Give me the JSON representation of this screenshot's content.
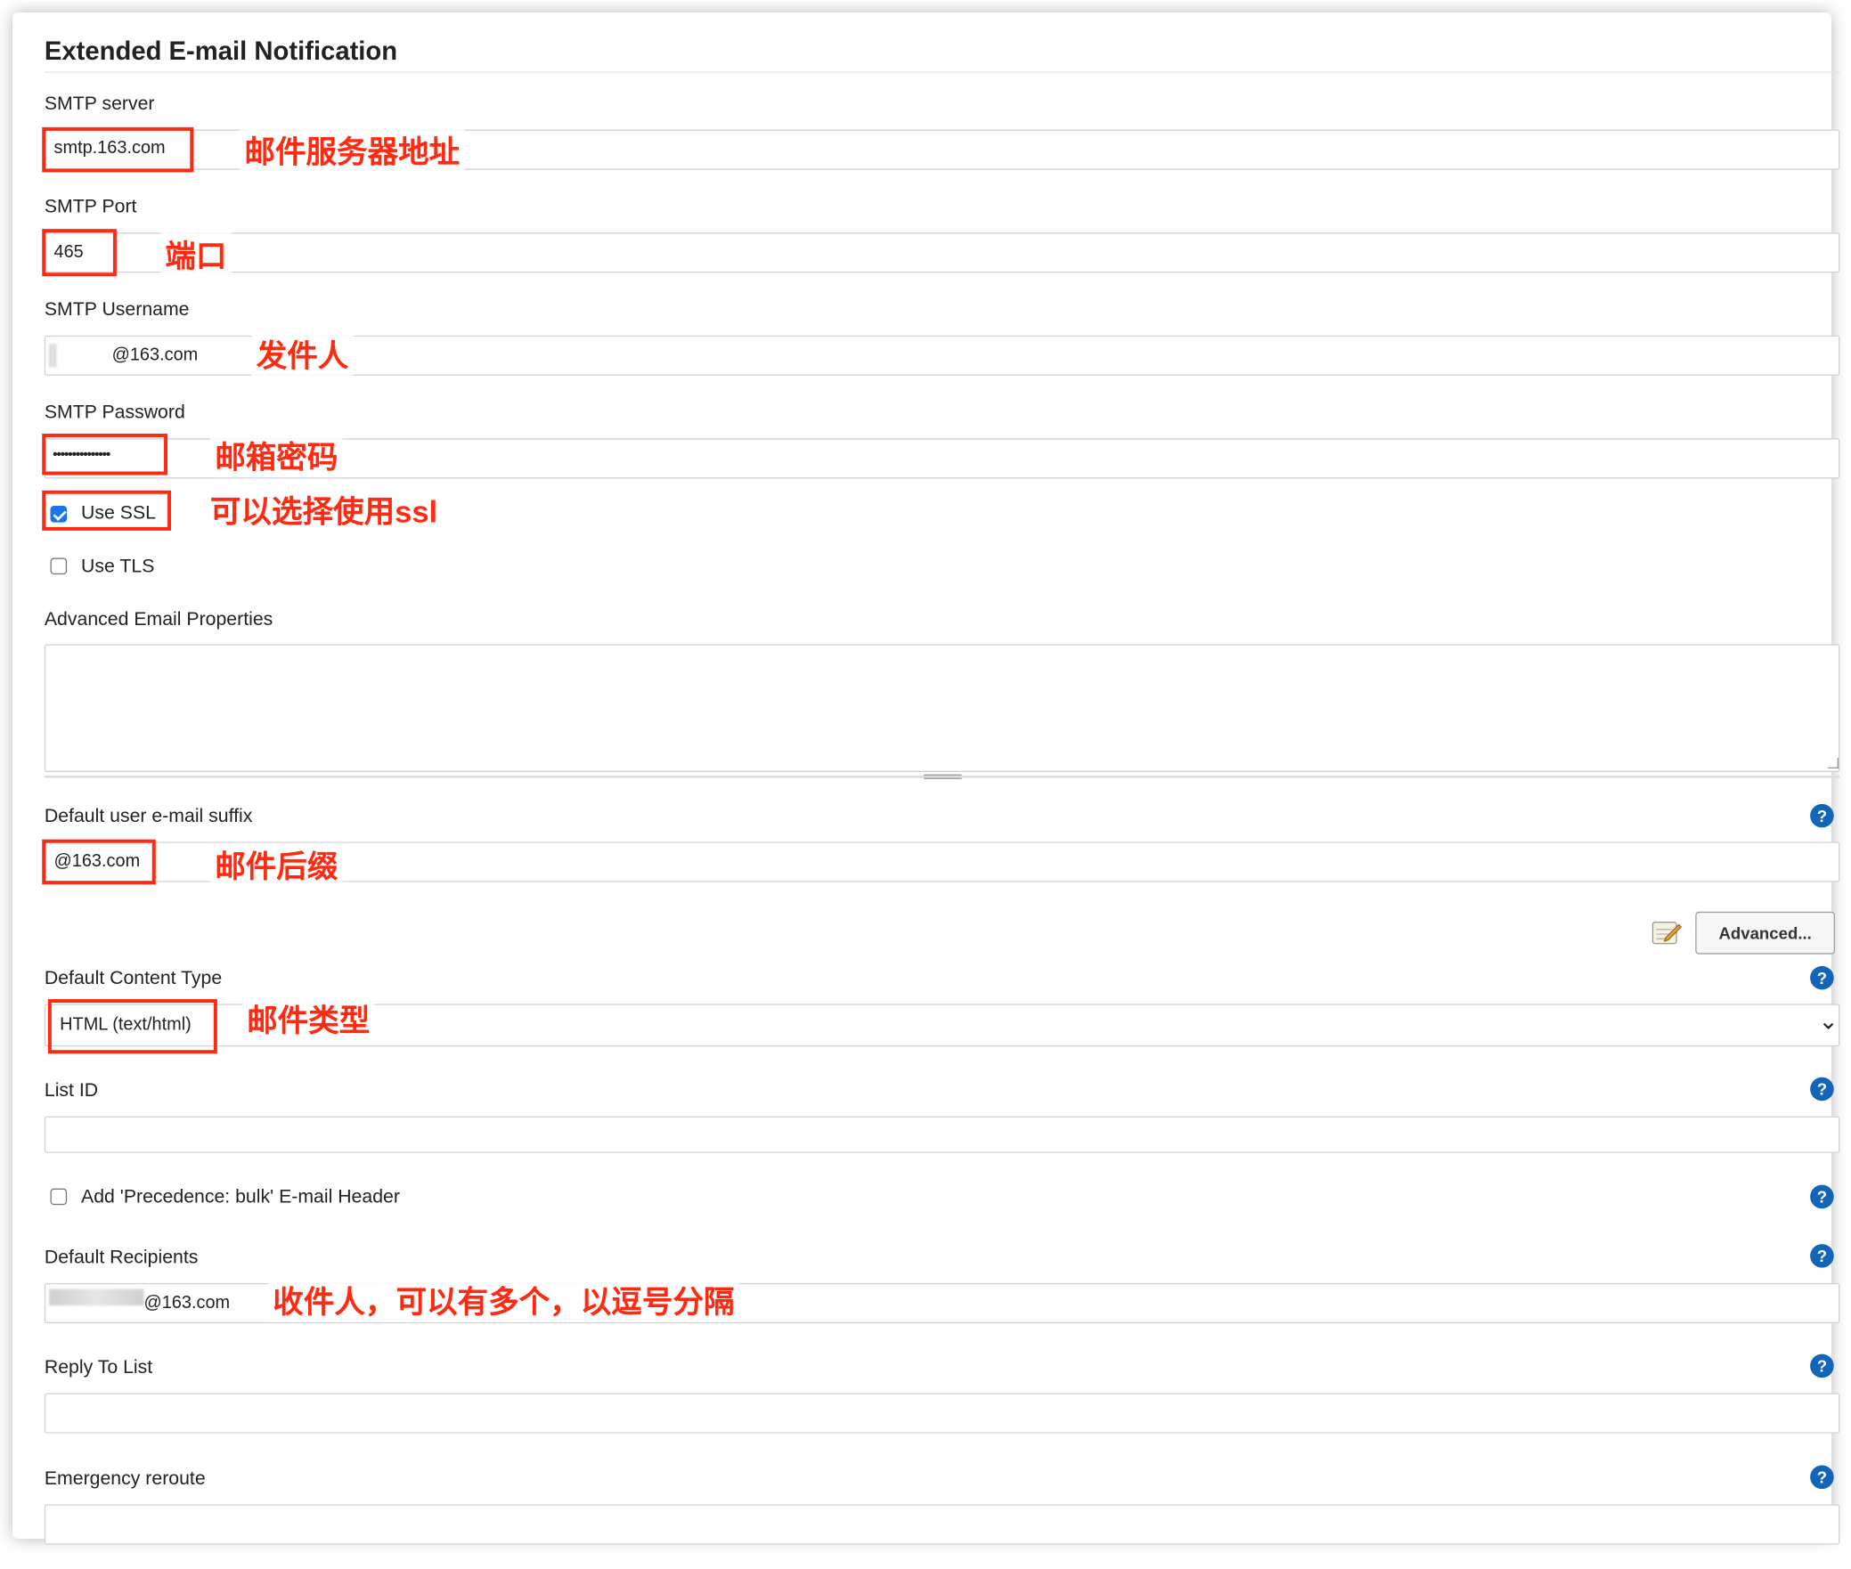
{
  "section_title": "Extended E-mail Notification",
  "smtp_server": {
    "label": "SMTP server",
    "value": "smtp.163.com",
    "annotation": "邮件服务器地址"
  },
  "smtp_port": {
    "label": "SMTP Port",
    "value": "465",
    "annotation": "端口"
  },
  "smtp_username": {
    "label": "SMTP Username",
    "value": "@163.com",
    "annotation": "发件人"
  },
  "smtp_password": {
    "label": "SMTP Password",
    "value": "•••••••••••••••",
    "annotation": "邮箱密码"
  },
  "use_ssl": {
    "label": "Use SSL",
    "checked": true,
    "annotation": "可以选择使用ssl"
  },
  "use_tls": {
    "label": "Use TLS",
    "checked": false
  },
  "advanced_email_properties": {
    "label": "Advanced Email Properties",
    "value": ""
  },
  "default_suffix": {
    "label": "Default user e-mail suffix",
    "value": "@163.com",
    "annotation": "邮件后缀"
  },
  "advanced_button": {
    "label": "Advanced..."
  },
  "default_content_type": {
    "label": "Default Content Type",
    "value": "HTML (text/html)",
    "annotation": "邮件类型"
  },
  "list_id": {
    "label": "List ID",
    "value": ""
  },
  "precedence_bulk": {
    "label": "Add 'Precedence: bulk' E-mail Header",
    "checked": false
  },
  "default_recipients": {
    "label": "Default Recipients",
    "value": "@163.com",
    "annotation": "收件人，可以有多个，以逗号分隔"
  },
  "reply_to_list": {
    "label": "Reply To List",
    "value": ""
  },
  "emergency_reroute": {
    "label": "Emergency reroute",
    "value": ""
  },
  "icons": {
    "help": "question-circle-icon",
    "notepad": "notepad-icon",
    "select": "chevron-down-icon"
  },
  "colors": {
    "annotation_red": "#ff2a12",
    "help_blue": "#1265b8",
    "checkbox_blue": "#1a73e8"
  },
  "help_glyph": "?",
  "select_glyph": "⌄"
}
